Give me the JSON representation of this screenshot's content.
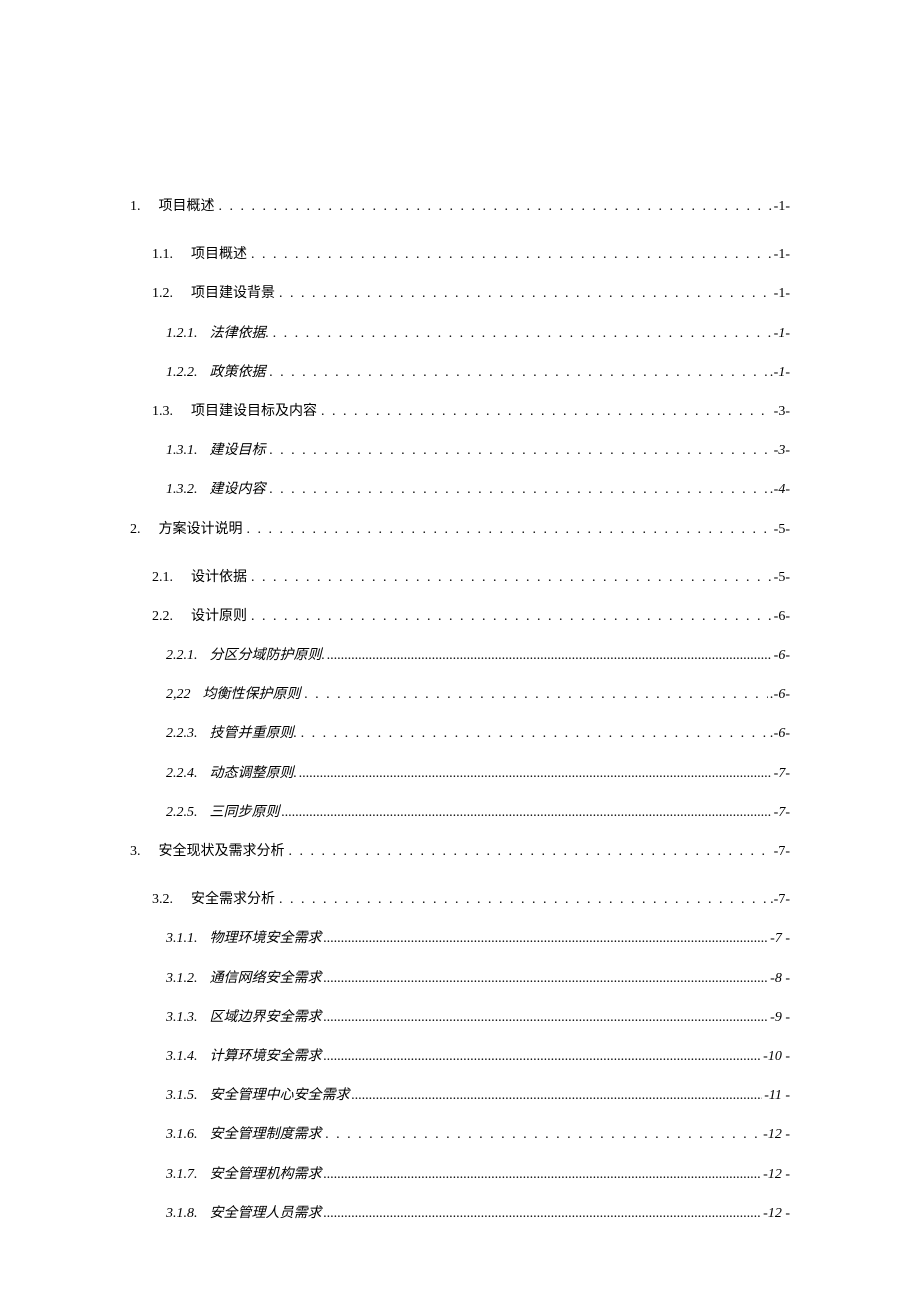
{
  "toc": [
    {
      "level": 1,
      "number": "1.",
      "title": "项目概述",
      "page": "-1-",
      "dots": "loose"
    },
    {
      "level": 2,
      "number": "1.1.",
      "title": "项目概述",
      "page": "-1-",
      "dots": "loose"
    },
    {
      "level": 2,
      "number": "1.2.",
      "title": "项目建设背景",
      "page": "-1-",
      "dots": "loose"
    },
    {
      "level": 3,
      "number": "1.2.1.",
      "title": "法律依据.",
      "page": "-1-",
      "dots": "loose"
    },
    {
      "level": 3,
      "number": "1.2.2.",
      "title": "政策依据",
      "page": ".-1-",
      "dots": "loose"
    },
    {
      "level": 2,
      "number": "1.3.",
      "title": "项目建设目标及内容",
      "page": "-3-",
      "dots": "loose"
    },
    {
      "level": 3,
      "number": "1.3.1.",
      "title": "建设目标",
      "page": "-3-",
      "dots": "loose"
    },
    {
      "level": 3,
      "number": "1.3.2.",
      "title": "建设内容",
      "page": ".-4-",
      "dots": "loose"
    },
    {
      "level": 1,
      "number": "2.",
      "title": "方案设计说明",
      "page": "-5-",
      "dots": "loose"
    },
    {
      "level": 2,
      "number": "2.1.",
      "title": "设计依据",
      "page": "-5-",
      "dots": "loose"
    },
    {
      "level": 2,
      "number": "2.2.",
      "title": "设计原则",
      "page": "-6-",
      "dots": "loose"
    },
    {
      "level": 3,
      "number": "2.2.1.",
      "title": "分区分域防护原则.",
      "page": "-6-",
      "dots": "tight"
    },
    {
      "level": 3,
      "number": "2,22",
      "title": "均衡性保护原则",
      "page": ".-6-",
      "dots": "loose"
    },
    {
      "level": 3,
      "number": "2.2.3.",
      "title": "技管并重原则.",
      "page": ".-6-",
      "dots": "loose"
    },
    {
      "level": 3,
      "number": "2.2.4.",
      "title": "动态调整原则.",
      "page": "-7-",
      "dots": "tight"
    },
    {
      "level": 3,
      "number": "2.2.5.",
      "title": "三同步原则",
      "page": "-7-",
      "dots": "tight"
    },
    {
      "level": 1,
      "number": "3.",
      "title": "安全现状及需求分析",
      "page": "-7-",
      "dots": "loose"
    },
    {
      "level": 2,
      "number": "3.2.",
      "title": "安全需求分析",
      "page": ".-7-",
      "dots": "loose"
    },
    {
      "level": 3,
      "number": "3.1.1.",
      "title": "物理环境安全需求",
      "page": "-7 -",
      "dots": "tight"
    },
    {
      "level": 3,
      "number": "3.1.2.",
      "title": "通信网络安全需求",
      "page": "-8 -",
      "dots": "tight"
    },
    {
      "level": 3,
      "number": "3.1.3.",
      "title": "区域边界安全需求",
      "page": "-9 -",
      "dots": "tight"
    },
    {
      "level": 3,
      "number": "3.1.4.",
      "title": "计算环境安全需求",
      "page": "-10 -",
      "dots": "tight"
    },
    {
      "level": 3,
      "number": "3.1.5.",
      "title": "安全管理中心安全需求",
      "page": "-11 -",
      "dots": "tight"
    },
    {
      "level": 3,
      "number": "3.1.6.",
      "title": "安全管理制度需求",
      "page": "-12 -",
      "dots": "loose"
    },
    {
      "level": 3,
      "number": "3.1.7.",
      "title": "安全管理机构需求",
      "page": "-12 -",
      "dots": "tight"
    },
    {
      "level": 3,
      "number": "3.1.8.",
      "title": "安全管理人员需求",
      "page": "-12 -",
      "dots": "tight"
    }
  ]
}
